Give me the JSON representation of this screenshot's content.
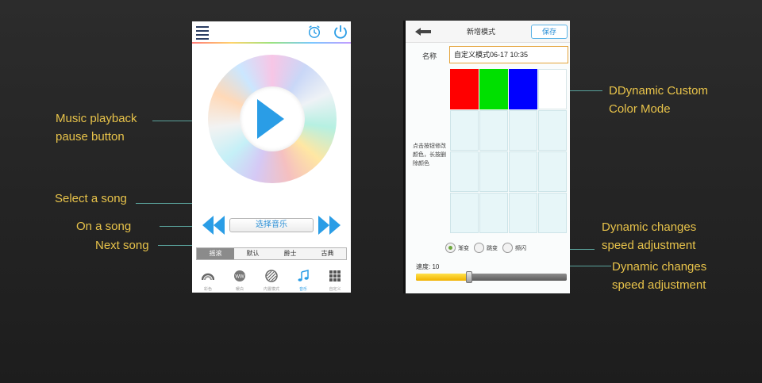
{
  "callouts": {
    "playback": [
      "Music playback",
      "pause button"
    ],
    "select_song": "Select a song",
    "prev_song": "On a song",
    "next_song": "Next song",
    "custom_mode": [
      "DDynamic Custom",
      "Color Mode"
    ],
    "speed_a": [
      "Dynamic changes",
      "speed adjustment"
    ],
    "speed_b": [
      "Dynamic changes",
      "speed adjustment"
    ]
  },
  "music_screen": {
    "select_music_label": "选择音乐",
    "genre_tabs": [
      "摇滚",
      "默认",
      "爵士",
      "古典"
    ],
    "active_genre": 0,
    "nav": [
      {
        "label": "彩色",
        "icon": "rainbow-icon"
      },
      {
        "label": "暖白",
        "icon": "ww-icon"
      },
      {
        "label": "内置模式",
        "icon": "pattern-icon"
      },
      {
        "label": "音乐",
        "icon": "music-note-icon"
      },
      {
        "label": "自定义",
        "icon": "grid-icon"
      }
    ],
    "active_nav": 3
  },
  "custom_screen": {
    "title": "新增模式",
    "save_label": "保存",
    "name_label": "名称",
    "name_value": "自定义模式06-17 10:35",
    "hint": "点击按钮修改颜色，长按删除颜色",
    "colors": [
      "#ff0000",
      "#00e000",
      "#0000ff",
      "#ffffff"
    ],
    "empty_cells": 12,
    "modes": [
      {
        "label": "渐变",
        "selected": true
      },
      {
        "label": "跳变",
        "selected": false
      },
      {
        "label": "频闪",
        "selected": false
      }
    ],
    "speed_label": "速度: 10",
    "speed_fraction": 0.35
  },
  "colors": {
    "accent": "#2a9de6",
    "callout_text": "#e8c34a",
    "callout_line": "#5aa39c"
  }
}
